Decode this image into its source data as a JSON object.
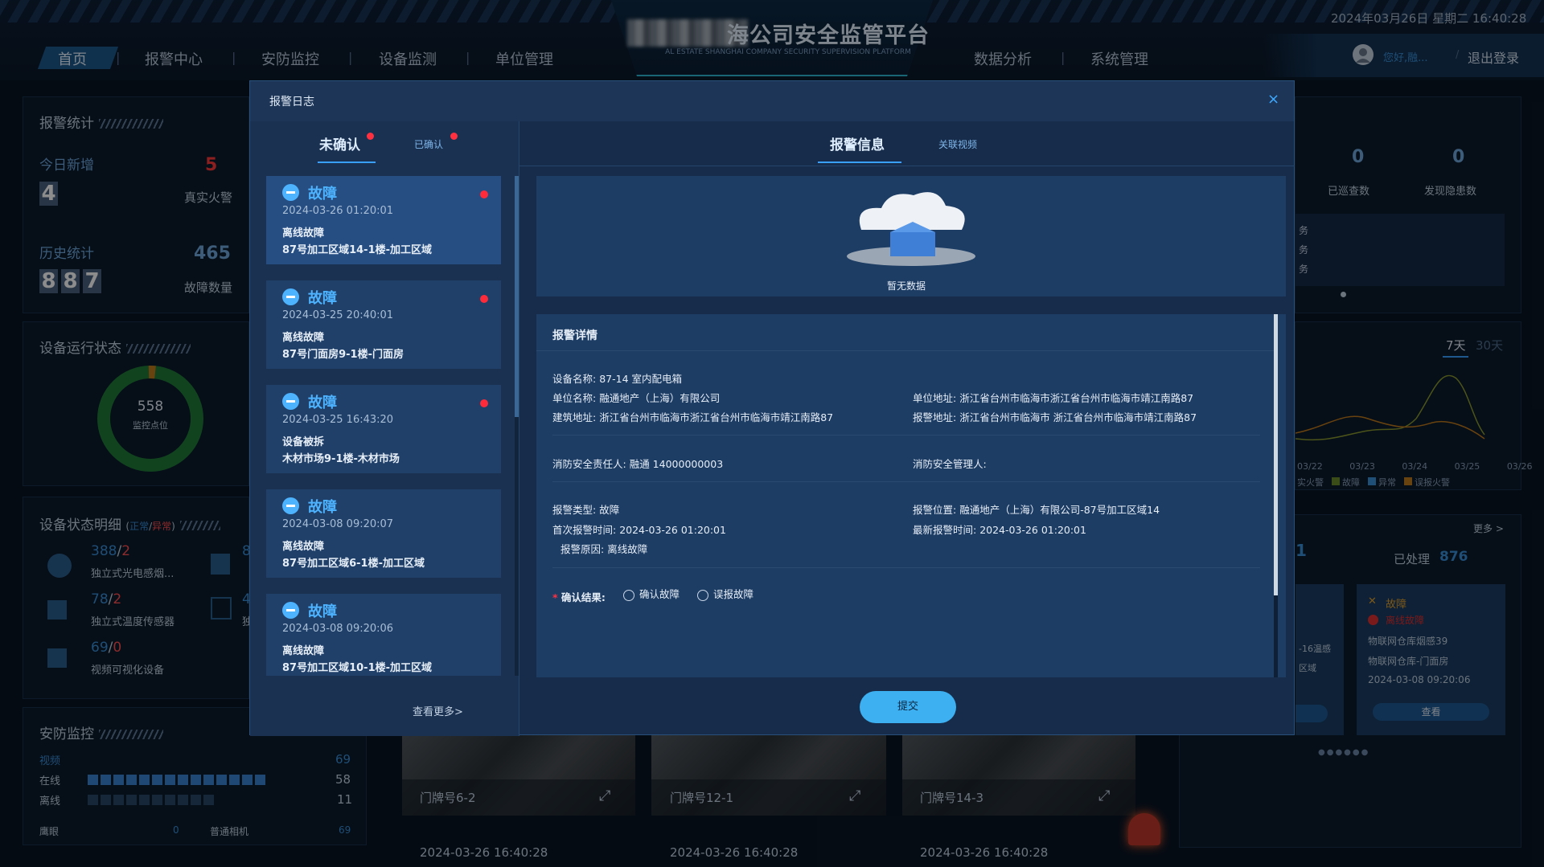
{
  "header": {
    "title_visible": "海公司安全监管平台",
    "subtitle": "AL ESTATE SHANGHAI COMPANY SECURITY SUPERVISION PLATFORM",
    "nav_left": [
      "首页",
      "报警中心",
      "安防监控",
      "设备监测",
      "单位管理"
    ],
    "nav_right": [
      "数据分析",
      "系统管理"
    ],
    "datetime": "2024年03月26日 星期二 16:40:28",
    "user_greeting": "您好,融...",
    "logout": "退出登录",
    "slash": "/"
  },
  "left": {
    "alarm_stats": {
      "title": "报警统计",
      "today_label": "今日新增",
      "today_digits": [
        "4"
      ],
      "fire_value": "5",
      "fire_label": "真实火警",
      "history_label": "历史统计",
      "history_digits": [
        "8",
        "8",
        "7"
      ],
      "fault_value": "465",
      "fault_label": "故障数量"
    },
    "device_status": {
      "title": "设备运行状态",
      "points": "558",
      "points_label": "监控点位"
    },
    "device_detail": {
      "title": "设备状态明细",
      "legend_normal": "正常",
      "legend_slash": "/",
      "legend_abnormal": "异常",
      "paren_open": "(",
      "paren_close": ")",
      "items": [
        {
          "normal": "388",
          "abnormal": "2",
          "name": "独立式光电感烟..."
        },
        {
          "normal": "78",
          "abnormal": "2",
          "name": "独立式温度传感器"
        },
        {
          "normal": "69",
          "abnormal": "0",
          "name": "视频可视化设备"
        }
      ],
      "partial_right": [
        "8",
        "4",
        "独"
      ]
    },
    "security": {
      "title": "安防监控",
      "video_label": "视频",
      "video_value": "69",
      "online_label": "在线",
      "online_value": "58",
      "offline_label": "离线",
      "offline_value": "11",
      "eagle_label": "鹰眼",
      "eagle_value": "0",
      "normal_cam_label": "普通相机",
      "normal_cam_value": "69"
    }
  },
  "right": {
    "patrol_count": "0",
    "patrol_label": "已巡查数",
    "hazard_count": "0",
    "hazard_label": "发现隐患数",
    "task_lines": [
      "务",
      "务",
      "务"
    ],
    "chart_tabs": [
      "7天",
      "30天"
    ],
    "chart_x": [
      "03/22",
      "03/23",
      "03/24",
      "03/25",
      "03/26"
    ],
    "chart_legend": [
      "实火警",
      "故障",
      "异常",
      "误报火警"
    ],
    "more": "更多 >",
    "handled_label": "已处理",
    "handled_value": "876",
    "partial_count": "1",
    "alarm_card": {
      "kind": "故障",
      "sub": "离线故障",
      "line1": "物联网仓库烟感39",
      "line2": "物联网仓库-门面房",
      "time": "2024-03-08 09:20:06",
      "btn": "查看"
    },
    "partial_card": [
      "-16温感",
      "区域"
    ]
  },
  "videos": [
    {
      "name": "门牌号6-2",
      "time": "2024-03-26 16:40:28"
    },
    {
      "name": "门牌号12-1",
      "time": "2024-03-26 16:40:28"
    },
    {
      "name": "门牌号14-3",
      "time": "2024-03-26 16:40:28"
    }
  ],
  "modal": {
    "title": "报警日志",
    "close": "×",
    "tabs_left": [
      {
        "label": "未确认"
      },
      {
        "label": "已确认"
      }
    ],
    "tabs_right": [
      {
        "label": "报警信息"
      },
      {
        "label": "关联视频"
      }
    ],
    "alarms": [
      {
        "kind": "故障",
        "time": "2024-03-26 01:20:01",
        "type": "离线故障",
        "location": "87号加工区域14-1楼-加工区域"
      },
      {
        "kind": "故障",
        "time": "2024-03-25 20:40:01",
        "type": "离线故障",
        "location": "87号门面房9-1楼-门面房"
      },
      {
        "kind": "故障",
        "time": "2024-03-25 16:43:20",
        "type": "设备被拆",
        "location": "木材市场9-1楼-木材市场"
      },
      {
        "kind": "故障",
        "time": "2024-03-08 09:20:07",
        "type": "离线故障",
        "location": "87号加工区域6-1楼-加工区域"
      },
      {
        "kind": "故障",
        "time": "2024-03-08 09:20:06",
        "type": "离线故障",
        "location": "87号加工区域10-1楼-加工区域"
      }
    ],
    "see_more": "查看更多>",
    "no_data": "暂无数据",
    "detail_title": "报警详情",
    "detail": {
      "device_name_label": "设备名称:",
      "device_name": "87-14 室内配电箱",
      "unit_name_label": "单位名称:",
      "unit_name": "融通地产（上海）有限公司",
      "unit_addr_label": "单位地址:",
      "unit_addr": "浙江省台州市临海市浙江省台州市临海市靖江南路87",
      "building_addr_label": "建筑地址:",
      "building_addr": "浙江省台州市临海市浙江省台州市临海市靖江南路87",
      "alarm_addr_label": "报警地址:",
      "alarm_addr": "浙江省台州市临海市 浙江省台州市临海市靖江南路87",
      "fire_resp_label": "消防安全责任人:",
      "fire_resp": "融通 14000000003",
      "fire_mgr_label": "消防安全管理人:",
      "fire_mgr": "",
      "alarm_type_label": "报警类型:",
      "alarm_type": "故障",
      "alarm_pos_label": "报警位置:",
      "alarm_pos": "融通地产（上海）有限公司-87号加工区域14",
      "first_time_label": "首次报警时间:",
      "first_time": "2024-03-26 01:20:01",
      "latest_time_label": "最新报警时间:",
      "latest_time": "2024-03-26 01:20:01",
      "reason_label": "报警原因:",
      "reason": "离线故障"
    },
    "confirm_label": "确认结果:",
    "required_mark": "*",
    "options": [
      "确认故障",
      "误报故障"
    ],
    "submit": "提交"
  },
  "colors": {
    "accent": "#3aa0ff",
    "alert": "#ff2b3b",
    "submit": "#3cb0f0",
    "donut": "#1f7a3a"
  }
}
